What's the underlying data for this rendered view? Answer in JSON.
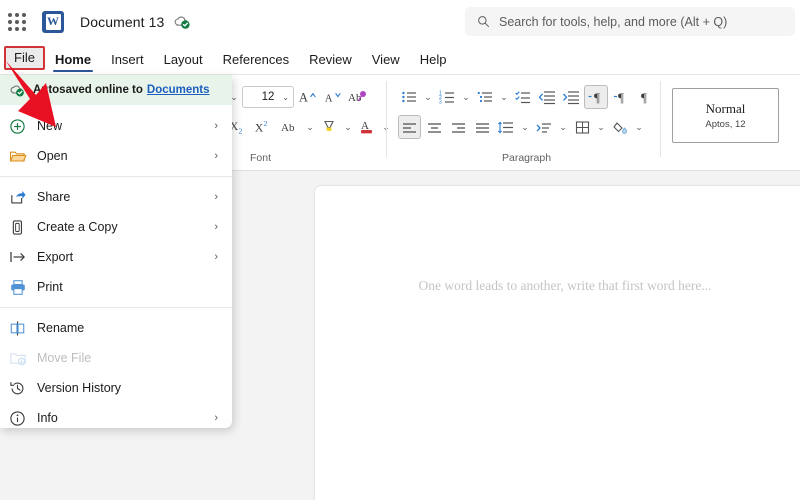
{
  "titlebar": {
    "app_launcher": "app-launcher",
    "app_logo_letter": "W",
    "document_title": "Document 13",
    "saved_status_icon": "cloud-saved-icon"
  },
  "search": {
    "placeholder": "Search for tools, help, and more (Alt + Q)",
    "icon": "search-icon"
  },
  "tabs": [
    {
      "label": "File",
      "state": "outlined"
    },
    {
      "label": "Home",
      "state": "active"
    },
    {
      "label": "Insert",
      "state": "normal"
    },
    {
      "label": "Layout",
      "state": "normal"
    },
    {
      "label": "References",
      "state": "normal"
    },
    {
      "label": "Review",
      "state": "normal"
    },
    {
      "label": "View",
      "state": "normal"
    },
    {
      "label": "Help",
      "state": "normal"
    }
  ],
  "ribbon": {
    "font_group": {
      "label": "Font",
      "font_size_value": "12",
      "row1": [
        "font-size-dropdown-chevron",
        "font-size-box",
        "grow-font-icon",
        "shrink-font-icon",
        "clear-formatting-icon"
      ],
      "row2": [
        "subscript-icon",
        "superscript-icon",
        "change-case-icon",
        "text-highlight-icon",
        "font-color-icon"
      ]
    },
    "paragraph_group": {
      "label": "Paragraph",
      "row1": [
        "bullets-icon",
        "numbering-icon",
        "multilevel-list-icon",
        "task-list-icon",
        "decrease-indent-icon",
        "increase-indent-icon",
        "ltr-text-direction-icon",
        "rtl-text-direction-icon",
        "show-formatting-marks-icon"
      ],
      "row2": [
        "align-left-icon",
        "align-center-icon",
        "align-right-icon",
        "justify-icon",
        "line-spacing-icon",
        "sort-icon",
        "borders-icon",
        "shading-icon"
      ],
      "dialog_launcher": "paragraph-dialog-launcher"
    },
    "styles_group": {
      "style_name": "Normal",
      "style_meta": "Aptos, 12"
    }
  },
  "file_menu": {
    "autosave_text": "Autosaved online to",
    "autosave_link": "Documents",
    "autosave_icon": "cloud-check-icon",
    "items": [
      {
        "label": "New",
        "icon": "plus-circle-icon",
        "chevron": "›",
        "disabled": false
      },
      {
        "label": "Open",
        "icon": "folder-open-icon",
        "chevron": "›",
        "disabled": false
      },
      {
        "label": "Share",
        "icon": "share-icon",
        "chevron": "›",
        "disabled": false
      },
      {
        "label": "Create a Copy",
        "icon": "copy-icon",
        "chevron": "›",
        "disabled": false
      },
      {
        "label": "Export",
        "icon": "export-icon",
        "chevron": "›",
        "disabled": false
      },
      {
        "label": "Print",
        "icon": "printer-icon",
        "chevron": "",
        "disabled": false
      },
      {
        "label": "Rename",
        "icon": "rename-icon",
        "chevron": "",
        "disabled": false
      },
      {
        "label": "Move File",
        "icon": "move-file-icon",
        "chevron": "",
        "disabled": true
      },
      {
        "label": "Version History",
        "icon": "history-icon",
        "chevron": "",
        "disabled": false
      },
      {
        "label": "Info",
        "icon": "info-circle-icon",
        "chevron": "›",
        "disabled": false
      }
    ]
  },
  "document": {
    "placeholder": "One word leads to another, write that first word here..."
  },
  "annotation": {
    "arrow": "red-pointer-arrow",
    "color": "#e81123"
  },
  "colors": {
    "brand": "#2b579a",
    "accent_red": "#d13438",
    "autosave_bg": "#e8f3e9",
    "link": "#1c5fbf",
    "canvas": "#f3f3f3"
  }
}
